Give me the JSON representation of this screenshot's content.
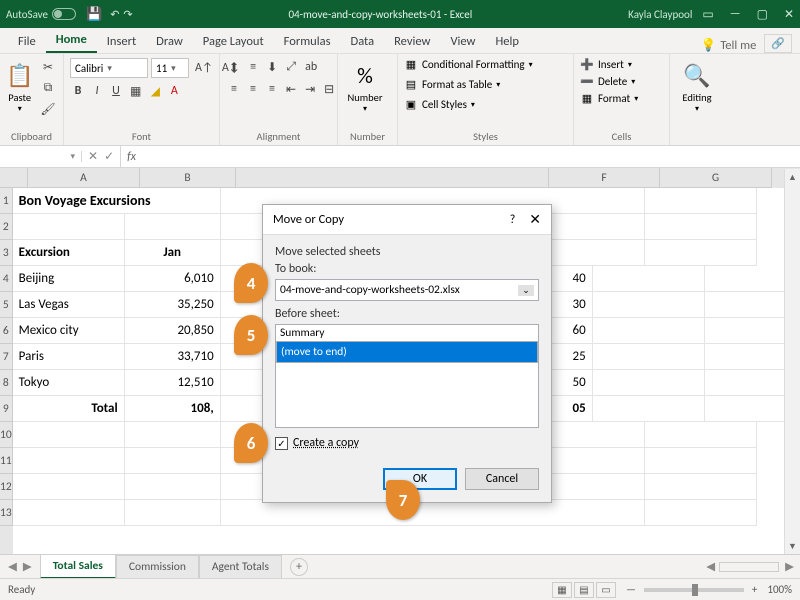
{
  "titlebar": {
    "autosave_label": "AutoSave",
    "autosave_state": "Off",
    "doc_title": "04-move-and-copy-worksheets-01 - Excel",
    "user": "Kayla Claypool"
  },
  "menu": {
    "items": [
      "File",
      "Home",
      "Insert",
      "Draw",
      "Page Layout",
      "Formulas",
      "Data",
      "Review",
      "View",
      "Help"
    ],
    "active": "Home",
    "tell_me": "Tell me"
  },
  "ribbon": {
    "clipboard": {
      "label": "Clipboard",
      "paste": "Paste"
    },
    "font": {
      "label": "Font",
      "family": "Calibri",
      "size": "11"
    },
    "alignment": {
      "label": "Alignment"
    },
    "number": {
      "label": "Number",
      "btn": "Number"
    },
    "styles": {
      "label": "Styles",
      "conditional": "Conditional Formatting",
      "table": "Format as Table",
      "cell": "Cell Styles"
    },
    "cells": {
      "label": "Cells",
      "insert": "Insert",
      "delete": "Delete",
      "format": "Format"
    },
    "editing": {
      "label": "Editing"
    }
  },
  "formula_bar": {
    "name_box": "",
    "fx": "fx"
  },
  "columns": [
    "A",
    "B",
    "F",
    "G"
  ],
  "rows": [
    "1",
    "2",
    "3",
    "4",
    "5",
    "6",
    "7",
    "8",
    "9",
    "10",
    "11",
    "12",
    "13"
  ],
  "sheet": {
    "title": "Bon Voyage Excursions",
    "header_excursion": "Excursion",
    "header_jan": "Jan",
    "data": [
      {
        "a": "Beijing",
        "b": "6,010",
        "e": "40"
      },
      {
        "a": "Las Vegas",
        "b": "35,250",
        "e": "30"
      },
      {
        "a": "Mexico city",
        "b": "20,850",
        "e": "60"
      },
      {
        "a": "Paris",
        "b": "33,710",
        "e": "25"
      },
      {
        "a": "Tokyo",
        "b": "12,510",
        "e": "50"
      }
    ],
    "total_label": "Total",
    "total_b": "108,",
    "total_e": "05"
  },
  "dialog": {
    "title": "Move or Copy",
    "move_selected": "Move selected sheets",
    "to_book_label": "To book:",
    "to_book_value": "04-move-and-copy-worksheets-02.xlsx",
    "before_sheet_label": "Before sheet:",
    "list": [
      "Summary",
      "(move to end)"
    ],
    "selected_index": 1,
    "create_copy_label": "Create a copy",
    "create_copy_checked": true,
    "ok": "OK",
    "cancel": "Cancel"
  },
  "callouts": {
    "c4": "4",
    "c5": "5",
    "c6": "6",
    "c7": "7"
  },
  "tabs": {
    "items": [
      "Total Sales",
      "Commission",
      "Agent Totals"
    ],
    "active": "Total Sales"
  },
  "status": {
    "ready": "Ready",
    "zoom": "100%"
  }
}
